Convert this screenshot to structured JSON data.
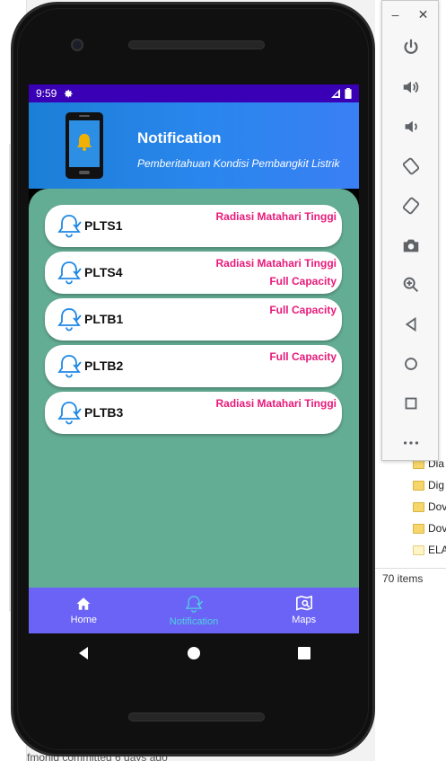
{
  "device": {
    "status_bar": {
      "time": "9:59"
    }
  },
  "app": {
    "header": {
      "title": "Notification",
      "subtitle": "Pemberitahuan Kondisi Pembangkit Listrik"
    },
    "notifications": [
      {
        "name": "PLTS1",
        "statuses": [
          "Radiasi Matahari Tinggi"
        ]
      },
      {
        "name": "PLTS4",
        "statuses": [
          "Radiasi Matahari Tinggi",
          "Full Capacity"
        ]
      },
      {
        "name": "PLTB1",
        "statuses": [
          "Full Capacity"
        ]
      },
      {
        "name": "PLTB2",
        "statuses": [
          "Full Capacity"
        ]
      },
      {
        "name": "PLTB3",
        "statuses": [
          "Radiasi Matahari Tinggi"
        ]
      }
    ],
    "bottom_nav": [
      {
        "label": "Home",
        "icon": "home-icon",
        "active": false
      },
      {
        "label": "Notification",
        "icon": "bell-check-icon",
        "active": true
      },
      {
        "label": "Maps",
        "icon": "map-search-icon",
        "active": false
      }
    ]
  },
  "colors": {
    "status_bar": "#3a00b5",
    "header_gradient_start": "#1c7fd6",
    "content_bg": "#64ad95",
    "status_text": "#e8197a",
    "bottom_nav": "#6b63f5",
    "active_nav": "#4fd0e0",
    "bell_outline": "#1e88e5"
  },
  "background": {
    "file_explorer_items": [
      "Dia",
      "Dig",
      "Dov",
      "Dov",
      "ELA"
    ],
    "item_count": "70 items",
    "commit_text": "fmonid committed 6 days ago"
  }
}
